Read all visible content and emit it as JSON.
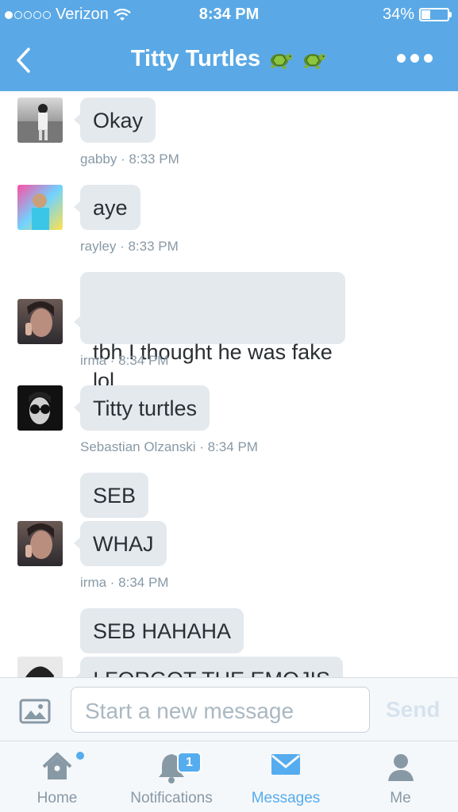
{
  "status_bar": {
    "carrier": "Verizon",
    "signal_bars_filled": 1,
    "signal_bars_total": 5,
    "time": "8:34 PM",
    "battery_label": "34%",
    "battery_level": 0.34
  },
  "nav": {
    "title": "Titty Turtles",
    "title_emoji": [
      "turtle-emoji",
      "turtle-emoji"
    ]
  },
  "messages": [
    {
      "avatar": "avatar-gabby",
      "bubbles": [
        "Okay"
      ],
      "meta": "gabby · 8:33 PM"
    },
    {
      "avatar": "avatar-rayley",
      "bubbles": [
        "aye"
      ],
      "meta": "rayley · 8:33 PM"
    },
    {
      "avatar": "avatar-irma",
      "bubbles": [
        "tbh I thought he was fake\nlol"
      ],
      "meta": "irma · 8:34 PM"
    },
    {
      "avatar": "avatar-sebastian",
      "bubbles": [
        "Titty turtles"
      ],
      "meta": "Sebastian Olzanski · 8:34 PM"
    },
    {
      "avatar": "avatar-irma",
      "bubbles": [
        "SEB",
        "WHAJ"
      ],
      "meta": "irma · 8:34 PM"
    },
    {
      "avatar": "avatar-partial",
      "bubbles": [
        "SEB HAHAHA",
        "I FORGOT THE EMOJIS"
      ]
    }
  ],
  "compose": {
    "placeholder": "Start a new message",
    "send_label": "Send"
  },
  "tabs": [
    {
      "label": "Home",
      "icon": "home-icon",
      "active": false,
      "has_dot": true
    },
    {
      "label": "Notifications",
      "icon": "bell-icon",
      "active": false,
      "badge": "1"
    },
    {
      "label": "Messages",
      "icon": "envelope-icon",
      "active": true
    },
    {
      "label": "Me",
      "icon": "person-icon",
      "active": false
    }
  ],
  "colors": {
    "header_bg": "#5aa9e6",
    "bubble_bg": "#e4e9ee",
    "accent": "#55acee",
    "meta_text": "#8899a6"
  }
}
